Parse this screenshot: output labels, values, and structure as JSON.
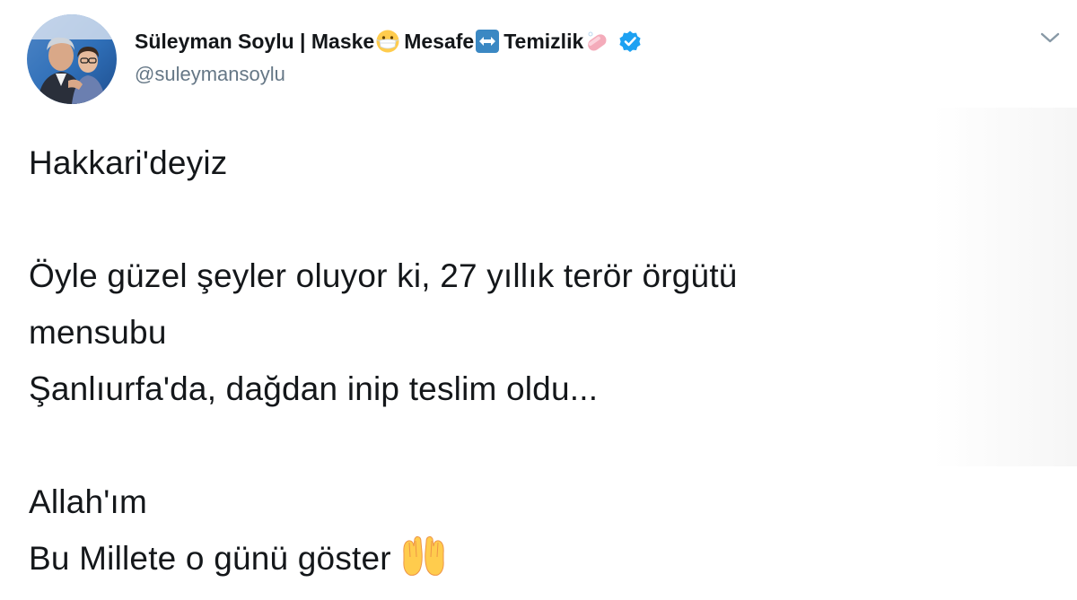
{
  "tweet": {
    "author": {
      "name_parts": [
        "Süleyman Soylu | Maske",
        "Mesafe",
        "Temizlik"
      ],
      "handle": "@suleymansoylu",
      "verified": true,
      "name_emojis": [
        "face-with-medical-mask-emoji",
        "left-right-arrow-emoji",
        "soap-emoji"
      ]
    },
    "text_lines": [
      "Hakkari'deyiz",
      "",
      "Öyle güzel şeyler oluyor ki, 27 yıllık terör örgütü",
      "mensubu",
      "Şanlıurfa'da, dağdan inip teslim oldu...",
      "",
      "Allah'ım",
      "Bu Millete o günü göster"
    ],
    "trailing_emoji": "palms-up-together-emoji"
  },
  "colors": {
    "text": "#14171a",
    "handle": "#657786",
    "verified": "#1da1f2",
    "caret": "#8899a6",
    "arrow_emoji_bg": "#3b88c3",
    "mask_emoji_face": "#ffcc4d",
    "soap_emoji": "#f4abba",
    "hands_emoji": "#ffcc4d"
  }
}
